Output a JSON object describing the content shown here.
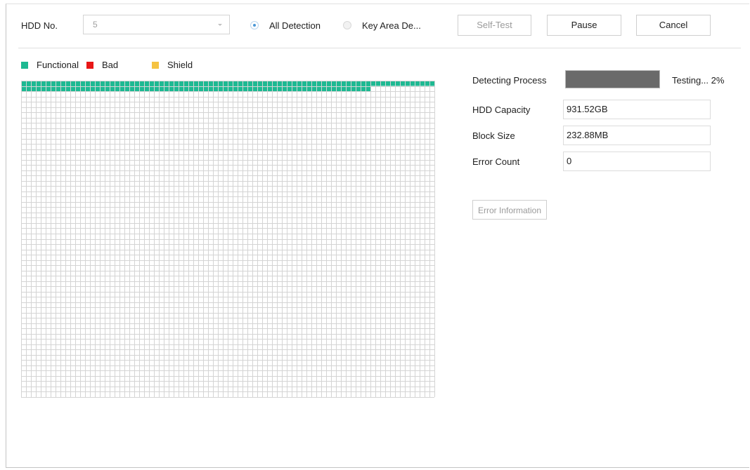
{
  "header": {
    "hdd_no_label": "HDD No.",
    "hdd_no_value": "5",
    "all_detection_label": "All Detection",
    "key_area_label": "Key Area De...",
    "all_detection_selected": true,
    "self_test_label": "Self-Test",
    "pause_label": "Pause",
    "cancel_label": "Cancel"
  },
  "legend": {
    "functional_label": "Functional",
    "bad_label": "Bad",
    "shield_label": "Shield"
  },
  "colors": {
    "functional": "#1db992",
    "bad": "#e81717",
    "shield": "#f5c342",
    "grid_line": "#d4d4d4",
    "progress_fill": "#6a6a6a"
  },
  "block_map": {
    "columns": 84,
    "rows": 60,
    "functional_count": 155,
    "bad_count": 0,
    "shield_count": 0
  },
  "details": {
    "detecting_process_label": "Detecting Process",
    "progress_fraction": 1.0,
    "progress_text": "Testing... 2%",
    "hdd_capacity_label": "HDD Capacity",
    "hdd_capacity_value": "931.52GB",
    "block_size_label": "Block Size",
    "block_size_value": "232.88MB",
    "error_count_label": "Error Count",
    "error_count_value": "0",
    "error_info_label": "Error Information"
  }
}
